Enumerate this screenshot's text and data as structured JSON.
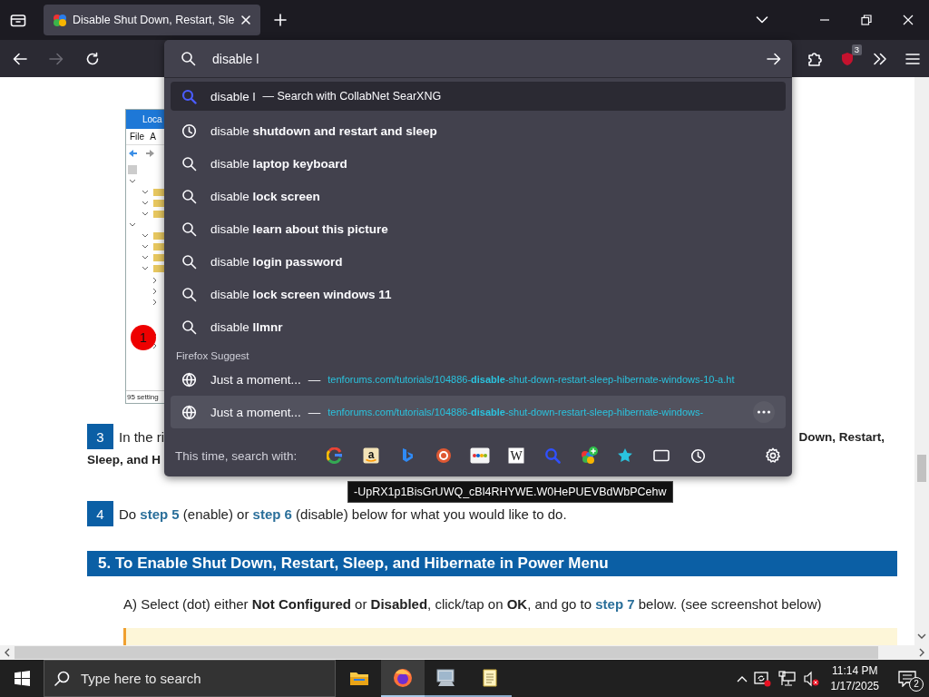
{
  "tab_bar": {
    "tabs": [
      {
        "title": "Disable Shut Down, Restart, Sle",
        "selected": true
      }
    ]
  },
  "address_bar": {
    "value": "disable l"
  },
  "toolbar": {
    "extension_badge": "3"
  },
  "url_dropdown": {
    "suggestions": [
      {
        "kind": "engine",
        "text": "disable l",
        "hint": "— Search with CollabNet SearXNG",
        "selected": true
      },
      {
        "kind": "history",
        "text": "disable **shutdown and restart and sleep**",
        "selected": false
      },
      {
        "kind": "search",
        "text": "disable **laptop keyboard**",
        "selected": false
      },
      {
        "kind": "search",
        "text": "disable **lock screen**",
        "selected": false
      },
      {
        "kind": "search",
        "text": "disable **learn about this picture**",
        "selected": false
      },
      {
        "kind": "search",
        "text": "disable **login password**",
        "selected": false
      },
      {
        "kind": "search",
        "text": "disable **lock screen windows 11**",
        "selected": false
      },
      {
        "kind": "search",
        "text": "disable **llmnr**",
        "selected": false
      }
    ],
    "group_label": "Firefox Suggest",
    "pages": [
      {
        "title": "Just a moment...",
        "separator": "—",
        "url": "tenforums.com/tutorials/104886-**disable**-shut-down-restart-sleep-hibernate-windows-10-a.ht",
        "hovered": false
      },
      {
        "title": "Just a moment...",
        "separator": "—",
        "url": "tenforums.com/tutorials/104886-**disable**-shut-down-restart-sleep-hibernate-windows-",
        "hovered": true
      }
    ],
    "search_with_label": "This time, search with:",
    "engines": [
      {
        "kind": "google"
      },
      {
        "kind": "amazon",
        "label": "a"
      },
      {
        "kind": "bing"
      },
      {
        "kind": "duckduckgo"
      },
      {
        "kind": "ebay"
      },
      {
        "kind": "wikipedia",
        "label": "W"
      },
      {
        "kind": "searxng"
      },
      {
        "kind": "extension"
      },
      {
        "kind": "bookmarks"
      },
      {
        "kind": "tabs"
      },
      {
        "kind": "history"
      }
    ]
  },
  "tooltip": {
    "text": "-UpRX1p1BisGrUWQ_cBl4RHYWE.W0HePUEVBdWbPCehw"
  },
  "page": {
    "screenshot": {
      "title": "Loca",
      "menu": [
        "File",
        "A"
      ],
      "marker": "1",
      "status": "95 setting"
    },
    "steps": [
      {
        "number": "3",
        "parts": [
          {
            "kind": "plain",
            "text": "In the ri"
          }
        ],
        "right": "Down, Restart,",
        "continuation": "Sleep, and H"
      },
      {
        "number": "4",
        "parts": [
          {
            "kind": "plain",
            "text": "Do "
          },
          {
            "kind": "link",
            "text": "step 5"
          },
          {
            "kind": "plain",
            "text": " (enable) or "
          },
          {
            "kind": "link",
            "text": "step 6"
          },
          {
            "kind": "plain",
            "text": " (disable) below for what you would like to do."
          }
        ]
      }
    ],
    "heading": "5. To Enable Shut Down, Restart, Sleep, and Hibernate in Power Menu",
    "paragraph": [
      {
        "kind": "plain",
        "text": "A) Select (dot) either "
      },
      {
        "kind": "bold",
        "text": "Not Configured"
      },
      {
        "kind": "plain",
        "text": " or "
      },
      {
        "kind": "bold",
        "text": "Disabled"
      },
      {
        "kind": "plain",
        "text": ", click/tap on "
      },
      {
        "kind": "bold",
        "text": "OK"
      },
      {
        "kind": "plain",
        "text": ", and go to "
      },
      {
        "kind": "link",
        "text": "step 7"
      },
      {
        "kind": "plain",
        "text": " below. (see screenshot below)"
      }
    ]
  },
  "taskbar": {
    "search_placeholder": "Type here to search",
    "apps": [
      {
        "kind": "explorer",
        "active": false,
        "running": false
      },
      {
        "kind": "firefox",
        "active": true,
        "running": true
      },
      {
        "kind": "computer",
        "active": false,
        "running": true
      },
      {
        "kind": "notepad",
        "active": false,
        "running": true
      }
    ],
    "time": "11:14 PM",
    "date": "1/17/2025",
    "notification_count": "2"
  }
}
